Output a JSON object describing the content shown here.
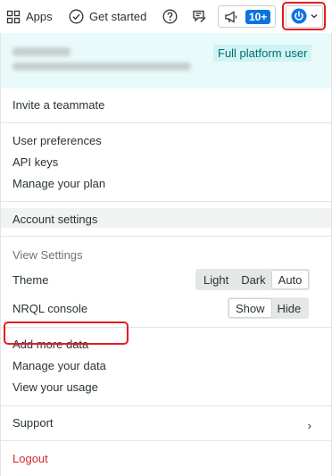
{
  "topbar": {
    "apps_label": "Apps",
    "get_started_label": "Get started",
    "badge_label": "10+",
    "icons": {
      "apps": "grid-icon",
      "get_started": "check-circle-icon",
      "help": "help-circle-icon",
      "feedback": "feedback-icon",
      "announce": "megaphone-icon",
      "profile": "power-icon",
      "caret": "chevron-down-icon"
    }
  },
  "menu": {
    "plan_badge": "Full platform user",
    "invite": "Invite a teammate",
    "user_preferences": "User preferences",
    "api_keys": "API keys",
    "manage_plan": "Manage your plan",
    "account_settings": "Account settings",
    "view_settings": "View Settings",
    "theme_label": "Theme",
    "theme_options": [
      "Light",
      "Dark",
      "Auto"
    ],
    "theme_selected": "Auto",
    "nrql_label": "NRQL console",
    "nrql_options": [
      "Show",
      "Hide"
    ],
    "nrql_selected": "Show",
    "add_more_data": "Add more data",
    "manage_data": "Manage your data",
    "view_usage": "View your usage",
    "support": "Support",
    "support_chevron": "›",
    "logout": "Logout"
  },
  "colors": {
    "accent_blue": "#0c74df",
    "highlight_red": "#e31b23",
    "logout_red": "#d7262d",
    "user_bg": "#e9fafa",
    "plan_badge_bg": "#cff4f3"
  }
}
